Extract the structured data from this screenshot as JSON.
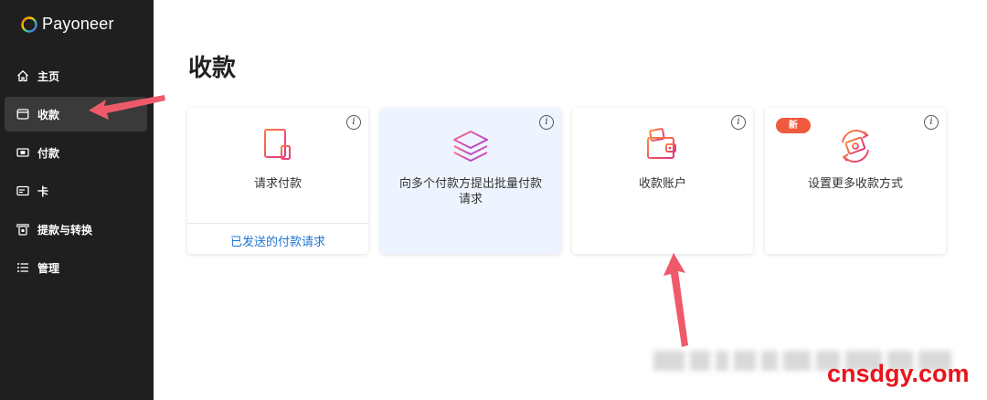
{
  "brand": {
    "name": "Payoneer"
  },
  "sidebar": {
    "items": [
      {
        "label": "主页",
        "icon": "home-icon"
      },
      {
        "label": "收款",
        "icon": "window-icon",
        "active": true
      },
      {
        "label": "付款",
        "icon": "cash-icon"
      },
      {
        "label": "卡",
        "icon": "card-icon"
      },
      {
        "label": "提款与转换",
        "icon": "withdraw-icon"
      },
      {
        "label": "管理",
        "icon": "list-icon"
      }
    ]
  },
  "main": {
    "title": "收款",
    "cards": [
      {
        "label": "请求付款",
        "link": "已发送的付款请求",
        "icon": "request-document-icon"
      },
      {
        "label": "向多个付款方提出批量付款请求",
        "icon": "layers-icon"
      },
      {
        "label": "收款账户",
        "icon": "wallet-icon"
      },
      {
        "label": "设置更多收款方式",
        "badge": "新",
        "icon": "exchange-cash-icon"
      }
    ],
    "info_glyph": "i"
  },
  "watermark": "cnsdgy.com",
  "colors": {
    "accent": "#e8151b",
    "sidebar": "#1f1f1f",
    "link": "#1f75d1",
    "badge": "#f05a3c"
  }
}
